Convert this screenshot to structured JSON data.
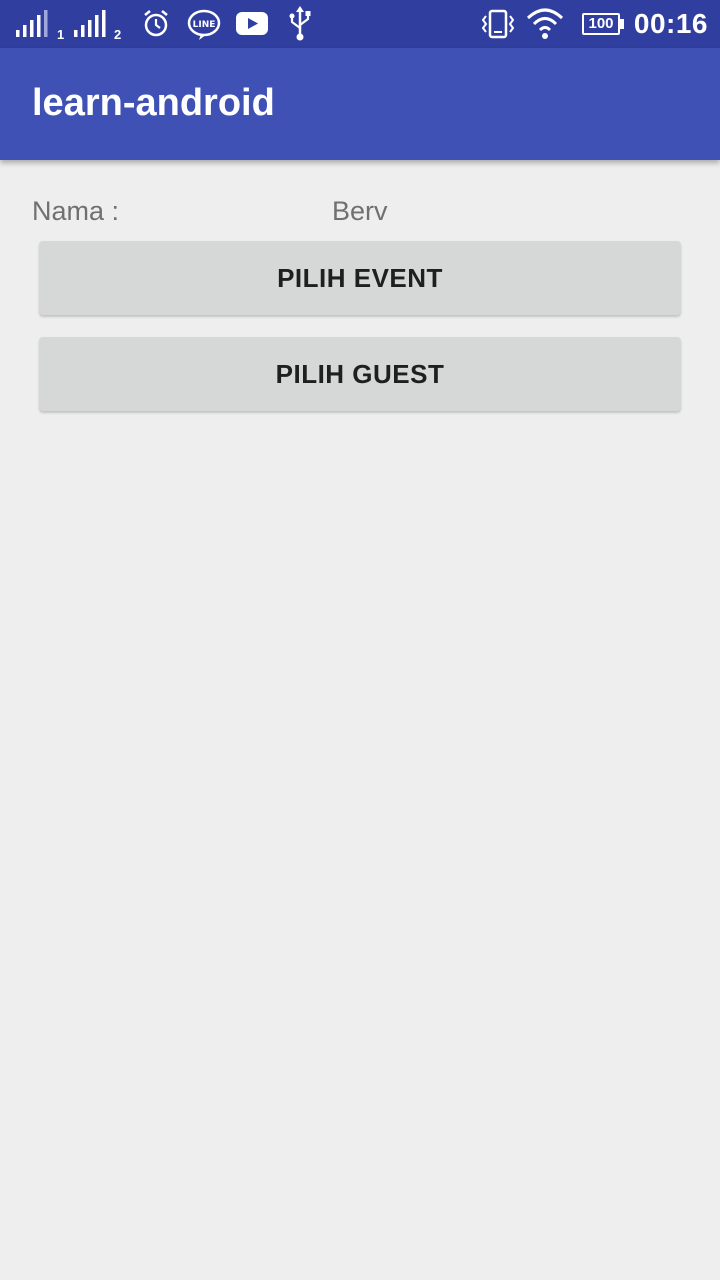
{
  "status_bar": {
    "sim1_label": "1",
    "sim2_label": "2",
    "icons": [
      "signal-icon",
      "signal-icon",
      "alarm-icon",
      "line-app-icon",
      "youtube-icon",
      "usb-icon",
      "vibrate-icon",
      "wifi-icon",
      "battery-icon"
    ],
    "battery": "100",
    "time": "00:16"
  },
  "app_bar": {
    "title": "learn-android",
    "color": "#3f51b5",
    "status_color": "#303f9f"
  },
  "form": {
    "name_label": "Nama :",
    "name_value": "Berv"
  },
  "buttons": {
    "pick_event": "PILIH EVENT",
    "pick_guest": "PILIH GUEST"
  }
}
